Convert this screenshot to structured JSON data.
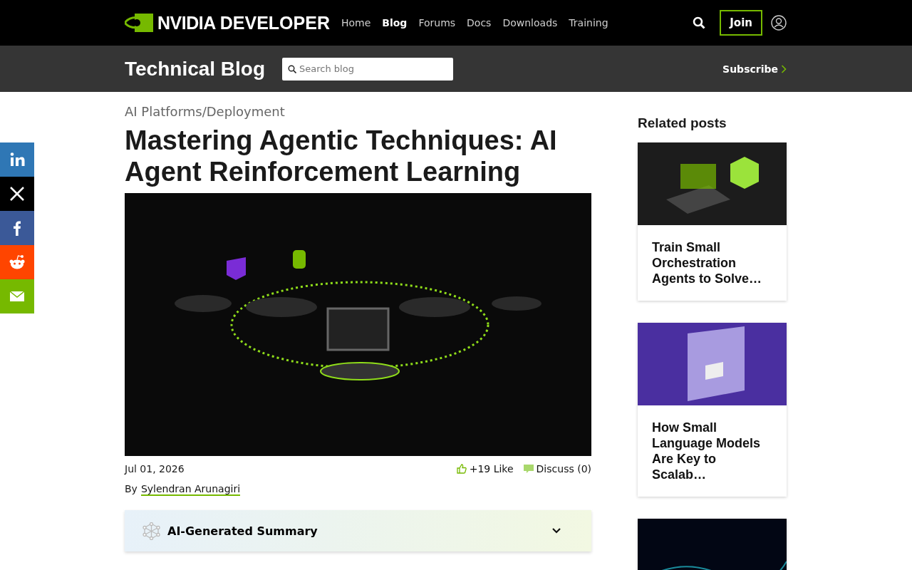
{
  "top_nav": {
    "logo_text": "NVIDIA",
    "logo_suffix": "DEVELOPER",
    "links": [
      {
        "label": "Home",
        "selected": false
      },
      {
        "label": "Blog",
        "selected": true
      },
      {
        "label": "Forums",
        "selected": false
      },
      {
        "label": "Docs",
        "selected": false
      },
      {
        "label": "Downloads",
        "selected": false
      },
      {
        "label": "Training",
        "selected": false
      }
    ],
    "join_label": "Join"
  },
  "blog_bar": {
    "title": "Technical Blog",
    "search": {
      "placeholder": "Search blog"
    },
    "subscribe_label": "Subscribe"
  },
  "share_bar": [
    {
      "kind": "linkedin",
      "color": "#2f77b5"
    },
    {
      "kind": "x",
      "color": "#000000"
    },
    {
      "kind": "facebook",
      "color": "#3b5998"
    },
    {
      "kind": "reddit",
      "color": "#ff4500"
    },
    {
      "kind": "email",
      "color": "#76b900"
    }
  ],
  "article": {
    "category": "AI Platforms/Deployment",
    "title": "Mastering Agentic Techniques: AI Agent Reinforcement Learning",
    "date": "Jul 01, 2026",
    "likes": "+19 Like",
    "discuss": "Discuss (0)",
    "byline_prefix": "By",
    "author": "Sylendran Arunagiri",
    "summary": {
      "label": "AI-Generated Summary",
      "expanded": false
    }
  },
  "related": {
    "heading": "Related posts",
    "posts": [
      {
        "title": "Train Small Orchestration Agents to Solve…",
        "kind": "green"
      },
      {
        "title": "How Small Language Models Are Key to Scalab…",
        "kind": "purple"
      },
      {
        "kind": "network"
      }
    ]
  }
}
